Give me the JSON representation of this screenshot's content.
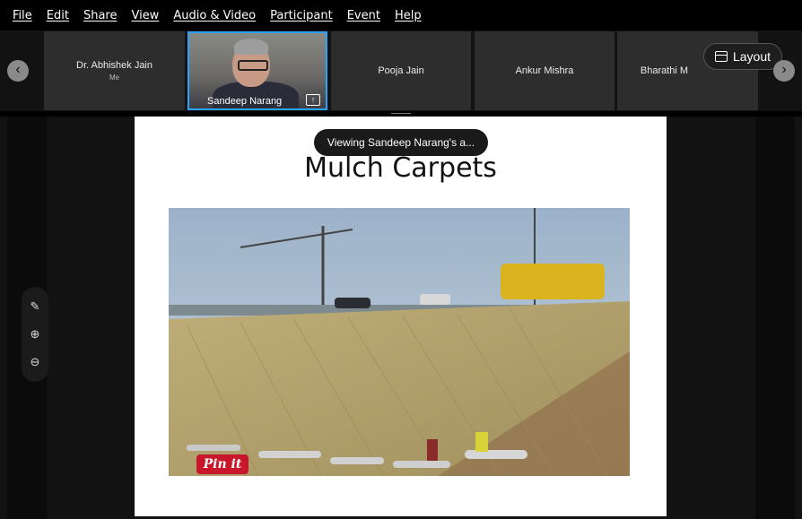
{
  "menu": [
    "File",
    "Edit",
    "Share",
    "View",
    "Audio & Video",
    "Participant",
    "Event",
    "Help"
  ],
  "participants": [
    {
      "name": "Dr. Abhishek Jain",
      "sub": "Me"
    },
    {
      "name": "Sandeep Narang"
    },
    {
      "name": "Pooja Jain"
    },
    {
      "name": "Ankur Mishra"
    },
    {
      "name": "Bharathi M"
    }
  ],
  "layout_button": "Layout",
  "toast": "Viewing Sandeep Narang's a...",
  "slide": {
    "title": "Mulch Carpets",
    "pin_label": "Pin it"
  },
  "icons": {
    "prev": "chevron-left-icon",
    "next": "chevron-right-icon",
    "share": "share-screen-icon"
  },
  "colors": {
    "accent": "#2aa3ff",
    "pin": "#c8172a"
  }
}
